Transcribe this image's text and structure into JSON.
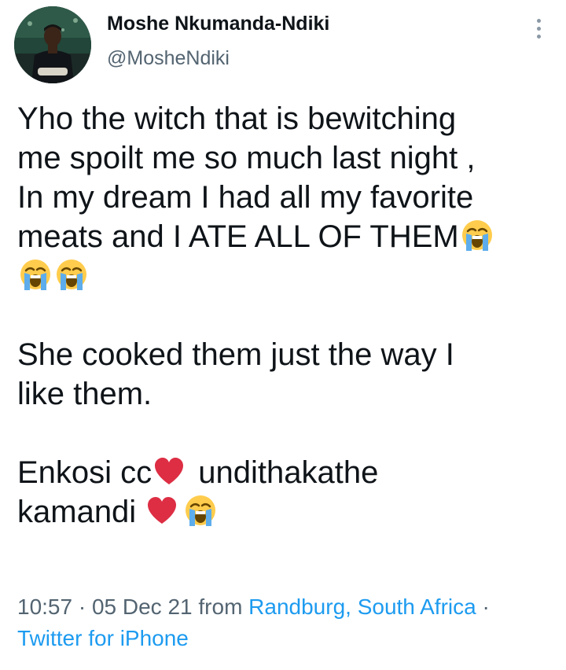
{
  "author": {
    "name": "Moshe Nkumanda-Ndiki",
    "handle": "@MosheNdiki"
  },
  "tweet": {
    "lines": [
      "Yho the witch that is bewitching",
      "me spoilt me so much last night ,",
      "In my dream I had all my favorite",
      "meats and I ATE ALL OF THEM",
      "She cooked them just the way I",
      "like them.",
      "Enkosi cc",
      "undithakathe",
      "kamandi"
    ],
    "emoji": [
      "loudly-crying-face",
      "red-heart"
    ]
  },
  "meta": {
    "time": "10:57",
    "separator": "·",
    "date": "05 Dec 21",
    "from": "from",
    "location": "Randburg, South Africa",
    "source": "Twitter for iPhone"
  },
  "colors": {
    "text": "#0f1419",
    "secondary": "#536471",
    "link": "#1d9bf0",
    "heart": "#dd2e44"
  }
}
